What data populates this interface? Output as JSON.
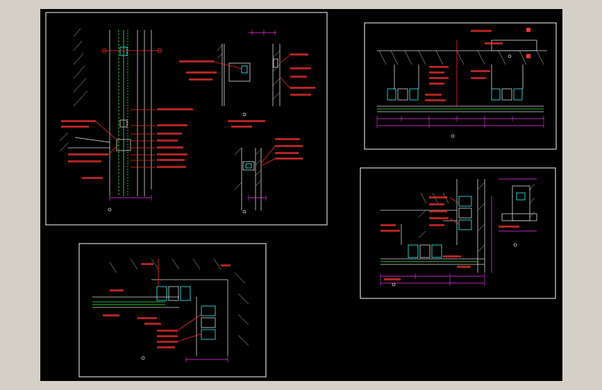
{
  "app": {
    "background_color": "#d4d0c8",
    "canvas_color": "#000000",
    "frame_color": "#ffffff",
    "accent_colors": {
      "annotation": "#ff2a2a",
      "dimension": "#ff33ff",
      "glass_line": "#33ff33",
      "profile": "#33ffff"
    }
  },
  "sheets": [
    {
      "name": "sheet-top-left",
      "detail_mark": "○"
    },
    {
      "name": "sheet-top-right",
      "detail_mark": "○"
    },
    {
      "name": "sheet-bottom-left",
      "detail_mark": "○"
    },
    {
      "name": "sheet-bottom-right",
      "detail_mark": "○"
    }
  ]
}
